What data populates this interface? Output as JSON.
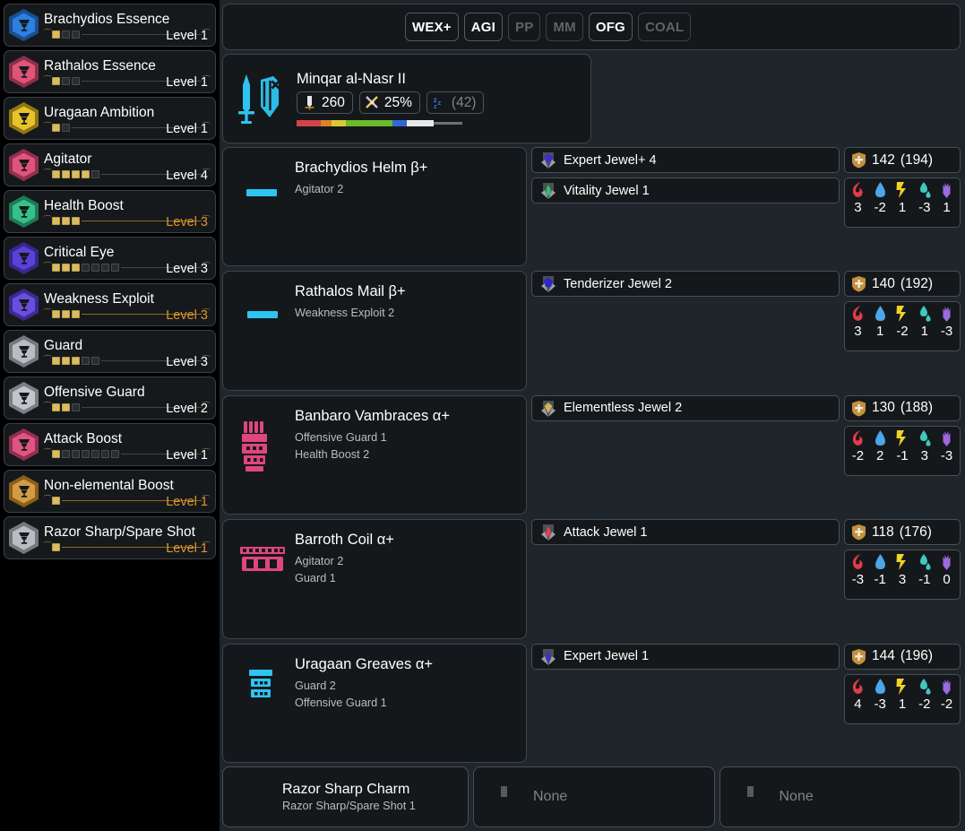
{
  "theme": {
    "bg": "#1e252b",
    "panel_bg": "#15181b",
    "panel_border": "#3e4449",
    "text": "#ffffff",
    "muted": "#b7bdc2",
    "accent_cap": "#e2952b",
    "pip_on": "#d9bb62"
  },
  "sidebar": {
    "skills": [
      {
        "name": "Brachydios Essence",
        "level_label": "Level 1",
        "at_cap": false,
        "pips_on": 1,
        "pips_off": 2,
        "icon": "set-bonus-hex-blue-icon",
        "color": "#2d7fe0",
        "edge": "#1a4f90"
      },
      {
        "name": "Rathalos Essence",
        "level_label": "Level 1",
        "at_cap": false,
        "pips_on": 1,
        "pips_off": 2,
        "icon": "set-bonus-hex-pink-icon",
        "color": "#e05477",
        "edge": "#8f2e48"
      },
      {
        "name": "Uragaan Ambition",
        "level_label": "Level 1",
        "at_cap": false,
        "pips_on": 1,
        "pips_off": 1,
        "icon": "set-bonus-hex-yellow-icon",
        "color": "#e7c32a",
        "edge": "#8f7714"
      },
      {
        "name": "Agitator",
        "level_label": "Level 4",
        "at_cap": false,
        "pips_on": 4,
        "pips_off": 1,
        "icon": "skill-hex-pink-icon",
        "color": "#e0537c",
        "edge": "#93304c"
      },
      {
        "name": "Health Boost",
        "level_label": "Level 3",
        "at_cap": true,
        "pips_on": 3,
        "pips_off": 0,
        "icon": "skill-hex-green-icon",
        "color": "#37c08a",
        "edge": "#1e7a55"
      },
      {
        "name": "Critical Eye",
        "level_label": "Level 3",
        "at_cap": false,
        "pips_on": 3,
        "pips_off": 4,
        "icon": "skill-hex-purple-icon",
        "color": "#5a42d6",
        "edge": "#38268f"
      },
      {
        "name": "Weakness Exploit",
        "level_label": "Level 3",
        "at_cap": true,
        "pips_on": 3,
        "pips_off": 0,
        "icon": "skill-hex-purple-icon",
        "color": "#6a4fdd",
        "edge": "#3d2a96"
      },
      {
        "name": "Guard",
        "level_label": "Level 3",
        "at_cap": false,
        "pips_on": 3,
        "pips_off": 2,
        "icon": "skill-hex-silver-icon",
        "color": "#b9bcc0",
        "edge": "#75787c"
      },
      {
        "name": "Offensive Guard",
        "level_label": "Level 2",
        "at_cap": false,
        "pips_on": 2,
        "pips_off": 1,
        "icon": "skill-hex-silver-icon",
        "color": "#c2c5c9",
        "edge": "#7c7f83"
      },
      {
        "name": "Attack Boost",
        "level_label": "Level 1",
        "at_cap": false,
        "pips_on": 1,
        "pips_off": 6,
        "icon": "skill-hex-pink-icon",
        "color": "#e05480",
        "edge": "#932f50"
      },
      {
        "name": "Non-elemental Boost",
        "level_label": "Level 1",
        "at_cap": true,
        "pips_on": 1,
        "pips_off": 0,
        "icon": "skill-hex-bronze-icon",
        "color": "#d39b43",
        "edge": "#8a5f19"
      },
      {
        "name": "Razor Sharp/Spare Shot",
        "level_label": "Level 1",
        "at_cap": true,
        "pips_on": 1,
        "pips_off": 0,
        "icon": "skill-hex-silver-icon",
        "color": "#b9bcc0",
        "edge": "#75787c"
      }
    ]
  },
  "toolbar": {
    "monster_icons": [
      {
        "name": "demondrug-pink-icon",
        "color": "#e36a85"
      },
      {
        "name": "might-seed-pink-icon",
        "color": "#e36a85"
      },
      {
        "name": "armorskin-tan-icon",
        "color": "#e0b184"
      },
      {
        "name": "adamant-seed-tan-icon",
        "color": "#e0b184"
      },
      {
        "name": "powercharm-green-icon",
        "color": "#5ec46a"
      }
    ],
    "badges": [
      {
        "label": "WEX+",
        "active": true
      },
      {
        "label": "AGI",
        "active": true
      },
      {
        "label": "PP",
        "active": false
      },
      {
        "label": "MM",
        "active": false
      },
      {
        "label": "OFG",
        "active": true
      },
      {
        "label": "COAL",
        "active": false
      }
    ]
  },
  "weapon": {
    "icon": "great-sword-shield-icon",
    "name": "Minqar al-Nasr II",
    "attack": {
      "icon": "attack-blade-icon",
      "value": "260",
      "dim": false
    },
    "affinity": {
      "icon": "affinity-crossed-icon",
      "value": "25%",
      "dim": false
    },
    "ailment": {
      "icon": "sleep-zzz-icon",
      "value": "(42)",
      "dim": true
    },
    "sharpness": [
      {
        "color": "#cf4545",
        "width": 27
      },
      {
        "color": "#d9832f",
        "width": 12
      },
      {
        "color": "#d9cb33",
        "width": 16
      },
      {
        "color": "#6aba2a",
        "width": 52
      },
      {
        "color": "#3367d6",
        "width": 16
      },
      {
        "color": "#e8e8e8",
        "width": 30
      },
      {
        "color": "#6e7378",
        "width": 32,
        "thin": true
      }
    ]
  },
  "armor_pieces": [
    {
      "slot": "head",
      "icon": "helm-icon",
      "icon_color": "#2ec4f1",
      "name": "Brachydios Helm β+",
      "skills": [
        "Agitator 2"
      ],
      "decorations": [
        {
          "name": "Expert Jewel+ 4",
          "gem": "expert-jewel-plus-icon",
          "gem_color": "#3a2fd0",
          "socket_color": "#9aa0a6"
        },
        {
          "name": "Vitality Jewel 1",
          "gem": "vitality-jewel-icon",
          "gem_color": "#2fbf6a",
          "socket_color": "#9aa0a6"
        }
      ],
      "defense": "142",
      "defense_max": "(194)",
      "resistances": [
        {
          "element": "fire",
          "value": "3"
        },
        {
          "element": "water",
          "value": "-2"
        },
        {
          "element": "thunder",
          "value": "1"
        },
        {
          "element": "ice",
          "value": "-3"
        },
        {
          "element": "dragon",
          "value": "1"
        }
      ]
    },
    {
      "slot": "chest",
      "icon": "mail-icon",
      "icon_color": "#2ec4f1",
      "name": "Rathalos Mail β+",
      "skills": [
        "Weakness Exploit 2"
      ],
      "decorations": [
        {
          "name": "Tenderizer Jewel 2",
          "gem": "tenderizer-jewel-icon",
          "gem_color": "#2d24c9",
          "socket_color": "#9aa0a6"
        }
      ],
      "defense": "140",
      "defense_max": "(192)",
      "resistances": [
        {
          "element": "fire",
          "value": "3"
        },
        {
          "element": "water",
          "value": "1"
        },
        {
          "element": "thunder",
          "value": "-2"
        },
        {
          "element": "ice",
          "value": "1"
        },
        {
          "element": "dragon",
          "value": "-3"
        }
      ]
    },
    {
      "slot": "arms",
      "icon": "vambraces-icon",
      "icon_color": "#e0467e",
      "name": "Banbaro Vambraces α+",
      "skills": [
        "Offensive Guard 1",
        "Health Boost 2"
      ],
      "decorations": [
        {
          "name": "Elementless Jewel 2",
          "gem": "elementless-jewel-icon",
          "gem_color": "#d7b159",
          "socket_color": "#9aa0a6"
        }
      ],
      "defense": "130",
      "defense_max": "(188)",
      "resistances": [
        {
          "element": "fire",
          "value": "-2"
        },
        {
          "element": "water",
          "value": "2"
        },
        {
          "element": "thunder",
          "value": "-1"
        },
        {
          "element": "ice",
          "value": "3"
        },
        {
          "element": "dragon",
          "value": "-3"
        }
      ]
    },
    {
      "slot": "waist",
      "icon": "coil-icon",
      "icon_color": "#e0467e",
      "name": "Barroth Coil α+",
      "skills": [
        "Agitator 2",
        "Guard 1"
      ],
      "decorations": [
        {
          "name": "Attack Jewel 1",
          "gem": "attack-jewel-icon",
          "gem_color": "#e0404a",
          "socket_color": "#9aa0a6"
        }
      ],
      "defense": "118",
      "defense_max": "(176)",
      "resistances": [
        {
          "element": "fire",
          "value": "-3"
        },
        {
          "element": "water",
          "value": "-1"
        },
        {
          "element": "thunder",
          "value": "3"
        },
        {
          "element": "ice",
          "value": "-1"
        },
        {
          "element": "dragon",
          "value": "0"
        }
      ]
    },
    {
      "slot": "legs",
      "icon": "greaves-icon",
      "icon_color": "#2ec4f1",
      "name": "Uragaan Greaves α+",
      "skills": [
        "Guard 2",
        "Offensive Guard 1"
      ],
      "decorations": [
        {
          "name": "Expert Jewel 1",
          "gem": "expert-jewel-icon",
          "gem_color": "#3a2fd0",
          "socket_color": "#9aa0a6"
        }
      ],
      "defense": "144",
      "defense_max": "(196)",
      "resistances": [
        {
          "element": "fire",
          "value": "4"
        },
        {
          "element": "water",
          "value": "-3"
        },
        {
          "element": "thunder",
          "value": "1"
        },
        {
          "element": "ice",
          "value": "-2"
        },
        {
          "element": "dragon",
          "value": "-2"
        }
      ]
    }
  ],
  "charms": [
    {
      "icon": "charm-icon",
      "name": "Razor Sharp Charm",
      "skill": "Razor Sharp/Spare Shot 1",
      "empty": false
    },
    {
      "icon": "empty-slot-icon",
      "name": "None",
      "skill": "",
      "empty": true
    },
    {
      "icon": "empty-slot-icon",
      "name": "None",
      "skill": "",
      "empty": true
    }
  ],
  "element_colors": {
    "fire": "#e03c4a",
    "water": "#4da6e8",
    "thunder": "#f0d325",
    "ice": "#3ec8c0",
    "dragon": "#9b6ae0"
  }
}
